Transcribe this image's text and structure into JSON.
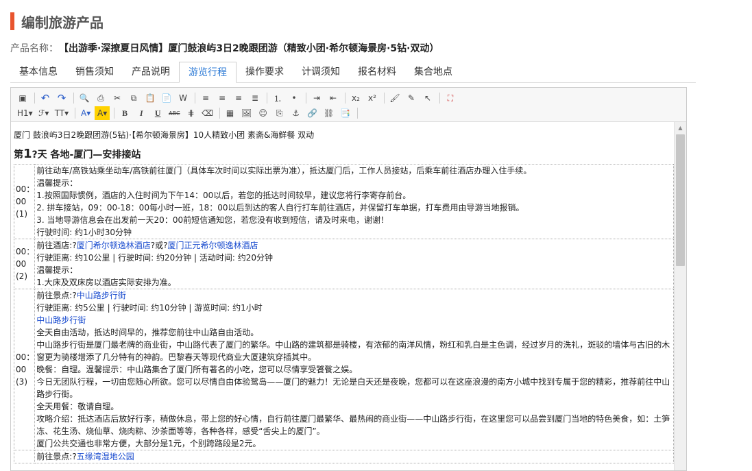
{
  "page_title": "编制旅游产品",
  "product": {
    "label": "产品名称：",
    "value": "【出游季·深撩夏日风情】厦门鼓浪屿3日2晚跟团游（精致小团·希尔顿海景房·5钻·双动）"
  },
  "tabs": [
    {
      "label": "基本信息"
    },
    {
      "label": "销售须知"
    },
    {
      "label": "产品说明"
    },
    {
      "label": "游览行程"
    },
    {
      "label": "操作要求"
    },
    {
      "label": "计调须知"
    },
    {
      "label": "报名材料"
    },
    {
      "label": "集合地点"
    }
  ],
  "active_tab": "游览行程",
  "toolbar": {
    "row1": [
      {
        "icon": "fullscreen-icon",
        "glyph": "▣"
      },
      {
        "icon": "undo-icon",
        "glyph": "↶"
      },
      {
        "icon": "redo-icon",
        "glyph": "↷"
      },
      {
        "icon": "preview-icon",
        "glyph": "🔍"
      },
      {
        "icon": "print-icon",
        "glyph": "⎙"
      },
      {
        "icon": "cut-icon",
        "glyph": "✂"
      },
      {
        "icon": "copy-icon",
        "glyph": "⧉"
      },
      {
        "icon": "paste-icon",
        "glyph": "📋"
      },
      {
        "icon": "paste-text-icon",
        "glyph": "📄"
      },
      {
        "icon": "paste-word-icon",
        "glyph": "W"
      },
      {
        "icon": "align-left-icon",
        "glyph": "≡"
      },
      {
        "icon": "align-center-icon",
        "glyph": "≡"
      },
      {
        "icon": "align-right-icon",
        "glyph": "≡"
      },
      {
        "icon": "align-justify-icon",
        "glyph": "≣"
      },
      {
        "icon": "ordered-list-icon",
        "glyph": "⒈"
      },
      {
        "icon": "unordered-list-icon",
        "glyph": "•"
      },
      {
        "icon": "indent-icon",
        "glyph": "⇥"
      },
      {
        "icon": "outdent-icon",
        "glyph": "⇤"
      },
      {
        "icon": "subscript-icon",
        "glyph": "x₂"
      },
      {
        "icon": "superscript-icon",
        "glyph": "x²"
      },
      {
        "icon": "format-brush-icon",
        "glyph": "🖌"
      },
      {
        "icon": "clear-format-icon",
        "glyph": "✎"
      },
      {
        "icon": "select-all-icon",
        "glyph": "↖"
      },
      {
        "icon": "source-code-icon",
        "glyph": "⛶"
      }
    ],
    "row2": [
      {
        "icon": "heading-icon",
        "glyph": "H1▾"
      },
      {
        "icon": "font-family-icon",
        "glyph": "ℱ▾"
      },
      {
        "icon": "font-size-icon",
        "glyph": "TT▾"
      },
      {
        "icon": "font-color-icon",
        "glyph": "A▾"
      },
      {
        "icon": "highlight-color-icon",
        "glyph": "A▾"
      },
      {
        "icon": "bold-icon",
        "glyph": "B"
      },
      {
        "icon": "italic-icon",
        "glyph": "I"
      },
      {
        "icon": "underline-icon",
        "glyph": "U"
      },
      {
        "icon": "strikethrough-icon",
        "glyph": "ABC"
      },
      {
        "icon": "line-height-icon",
        "glyph": "⋕"
      },
      {
        "icon": "eraser-icon",
        "glyph": "⌫"
      },
      {
        "icon": "table-icon",
        "glyph": "▦"
      },
      {
        "icon": "insert-image-icon",
        "glyph": "🖼"
      },
      {
        "icon": "emoticon-icon",
        "glyph": "☺"
      },
      {
        "icon": "page-break-icon",
        "glyph": "⎘"
      },
      {
        "icon": "anchor-icon",
        "glyph": "⚓"
      },
      {
        "icon": "link-icon",
        "glyph": "🔗"
      },
      {
        "icon": "unlink-icon",
        "glyph": "⛓"
      },
      {
        "icon": "template-icon",
        "glyph": "📑"
      }
    ]
  },
  "content": {
    "intro": "厦门 鼓浪屿3日2晚跟团游(5钻)·【希尔顿海景房】10人精致小团 素斋&海鲜餐 双动",
    "day": {
      "prefix": "第",
      "num": "1",
      "rest": "?天 各地-厦门—安排接站"
    },
    "rows": [
      {
        "time": [
          "00：",
          "00",
          "(1)"
        ],
        "lines": [
          [
            {
              "t": "前往动车/高铁站乘坐动车/高铁前往厦门（具体车次时间以实际出票为准），抵达厦门后，工作人员接站，后乘车前往酒店办理入住手续。"
            }
          ],
          [
            {
              "t": "温馨提示："
            }
          ],
          [
            {
              "t": "1.按照国际惯例，酒店的入住时间为下午14：00以后，若您的抵达时间较早，建议您将行李寄存前台。"
            }
          ],
          [
            {
              "t": "2. 拼车接站，09：00-18：00每小时一班，18：00以后到达的客人自行打车前往酒店，并保留打车单据，打车费用由导游当地报销。"
            }
          ],
          [
            {
              "t": "3. 当地导游信息会在出发前一天20：00前短信通知您，若您没有收到短信，请及时来电，谢谢！"
            }
          ],
          [
            {
              "t": "行驶时间: 约1小时30分钟"
            }
          ]
        ]
      },
      {
        "time": [
          "00：",
          "00",
          "(2)"
        ],
        "lines": [
          [
            {
              "t": "前往酒店:?"
            },
            {
              "t": "厦门希尔顿逸林酒店",
              "link": true
            },
            {
              "t": "?或?"
            },
            {
              "t": "厦门正元希尔顿逸林酒店",
              "link": true
            }
          ],
          [
            {
              "t": "行驶距离: 约10公里 | 行驶时间: 约20分钟 | 活动时间: 约20分钟"
            }
          ],
          [
            {
              "t": "温馨提示："
            }
          ],
          [
            {
              "t": "1.大床及双床房以酒店实际安排为准。"
            }
          ]
        ]
      },
      {
        "time": [
          "00：",
          "00",
          "(3)"
        ],
        "lines": [
          [
            {
              "t": "前往景点:?"
            },
            {
              "t": "中山路步行街",
              "link": true
            }
          ],
          [
            {
              "t": "行驶距离: 约5公里 | 行驶时间: 约10分钟 | 游览时间: 约1小时"
            }
          ],
          [
            {
              "t": "中山路步行街",
              "link": true
            }
          ],
          [
            {
              "t": "全天自由活动，抵达时间早的，推荐您前往中山路自由活动。"
            }
          ],
          [
            {
              "t": "中山路步行街是厦门最老牌的商业街，中山路代表了厦门的繁华。中山路的建筑都是骑楼，有浓郁的南洋风情，粉红和乳白是主色调，经过岁月的洗礼，斑驳的墙体与古旧的木窗更为骑楼增添了几分特有的神韵。巴黎春天等现代商业大厦建筑穿插其中。"
            }
          ],
          [
            {
              "t": "晚餐：自理。温馨提示：中山路集合了厦门所有著名的小吃，您可以尽情享受饕餮之娱。"
            }
          ],
          [
            {
              "t": "今日无团队行程，一切由您随心所欲。您可以尽情自由体验鹭岛——厦门的魅力！无论是白天还是夜晚，您都可以在这座浪漫的南方小城中找到专属于您的精彩，推荐前往中山路步行街。"
            }
          ],
          [
            {
              "t": "全天用餐：敬请自理。"
            }
          ],
          [
            {
              "t": "攻略介绍：抵达酒店后放好行李，稍做休息，带上您的好心情，自行前往厦门最繁华、最热闹的商业街——中山路步行街，在这里您可以品尝到厦门当地的特色美食，如：土笋冻、花生汤、烧仙草、烧肉粽、沙茶面等等，各种各样，感受“舌尖上的厦门”。"
            }
          ],
          [
            {
              "t": "厦门公共交通也非常方便，大部分是1元，个别跨路段是2元。"
            }
          ]
        ]
      },
      {
        "time": [
          "",
          "",
          ""
        ],
        "lines": [
          [
            {
              "t": "前往景点:?"
            },
            {
              "t": "五缘湾湿地公园",
              "link": true
            }
          ]
        ]
      }
    ]
  }
}
